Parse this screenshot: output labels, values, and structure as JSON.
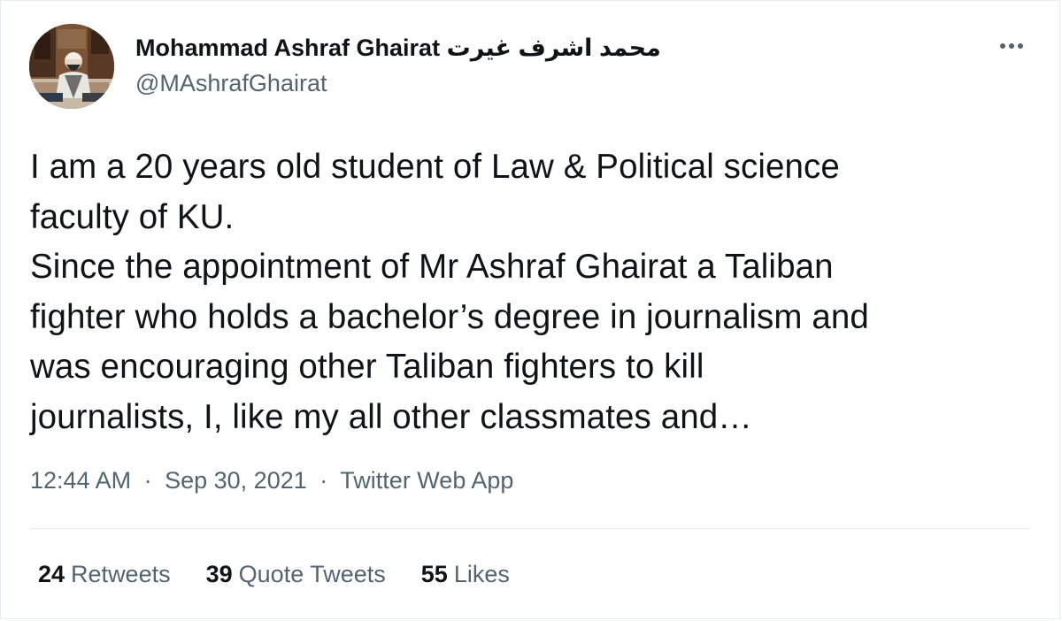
{
  "tweet": {
    "author": {
      "display_name": "Mohammad Ashraf Ghairat محمد اشرف غیرت",
      "handle": "@MAshrafGhairat",
      "avatar_icon": "profile-photo"
    },
    "more_icon": "more-horizontal-icon",
    "text_lines": "I am a 20 years old student of Law & Political science\nfaculty of KU.\nSince the appointment of Mr Ashraf Ghairat a Taliban\nfighter who holds a bachelor’s degree in journalism and\nwas encouraging other Taliban fighters to kill\njournalists, I, like my all other classmates and…",
    "meta": {
      "time": "12:44 AM",
      "separator": "·",
      "date": "Sep 30, 2021",
      "source": "Twitter Web App"
    },
    "stats": {
      "retweets_count": "24",
      "retweets_label": "Retweets",
      "quotes_count": "39",
      "quotes_label": "Quote Tweets",
      "likes_count": "55",
      "likes_label": "Likes"
    }
  },
  "colors": {
    "text_primary": "#0f1419",
    "text_secondary": "#536471",
    "divider": "#e6ecf0"
  }
}
